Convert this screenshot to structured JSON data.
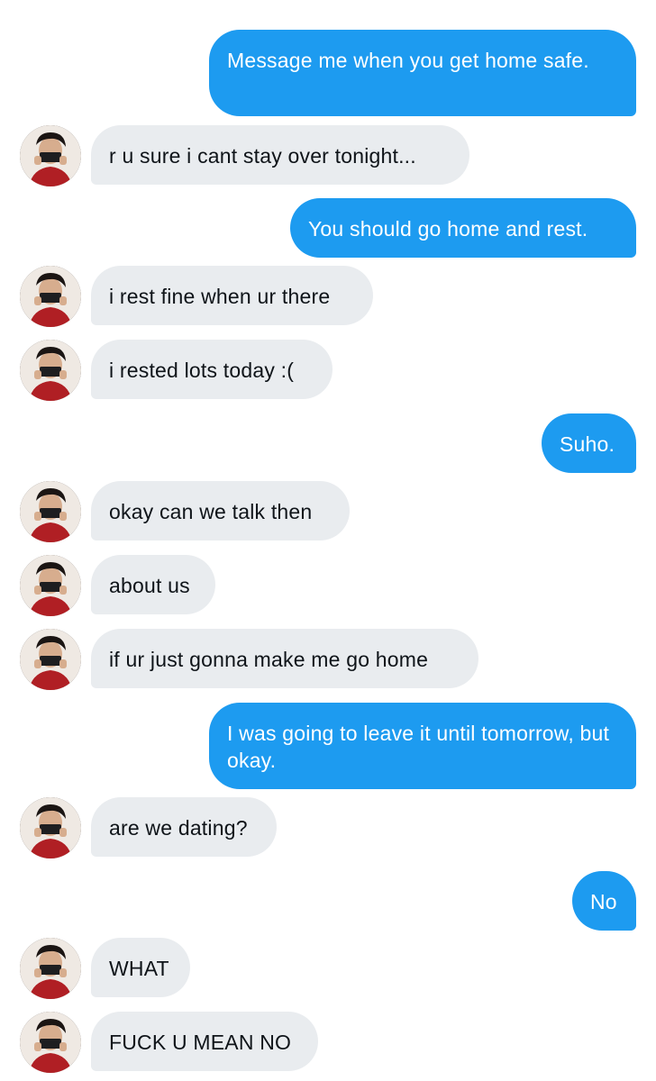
{
  "conversation": {
    "messages": [
      {
        "from": "me",
        "text": "Message me when you get home safe."
      },
      {
        "from": "them",
        "text": "r u sure i cant stay over tonight..."
      },
      {
        "from": "me",
        "text": "You should go home and rest."
      },
      {
        "from": "them",
        "text": "i rest fine when ur there"
      },
      {
        "from": "them",
        "text": "i rested lots today :("
      },
      {
        "from": "me",
        "text": "Suho."
      },
      {
        "from": "them",
        "text": "okay can we talk then"
      },
      {
        "from": "them",
        "text": "about us"
      },
      {
        "from": "them",
        "text": "if ur just gonna make me go home"
      },
      {
        "from": "me",
        "text": "I was going to leave it until tomorrow, but okay."
      },
      {
        "from": "them",
        "text": "are we dating?"
      },
      {
        "from": "me",
        "text": "No"
      },
      {
        "from": "them",
        "text": "WHAT"
      },
      {
        "from": "them",
        "text": "FUCK U MEAN NO"
      }
    ]
  },
  "colors": {
    "outgoing_bubble": "#1d9bf0",
    "incoming_bubble": "#e9ecef",
    "outgoing_text": "#ffffff",
    "incoming_text": "#0f1419"
  },
  "icons": {
    "avatar": "contact-avatar-photo"
  }
}
